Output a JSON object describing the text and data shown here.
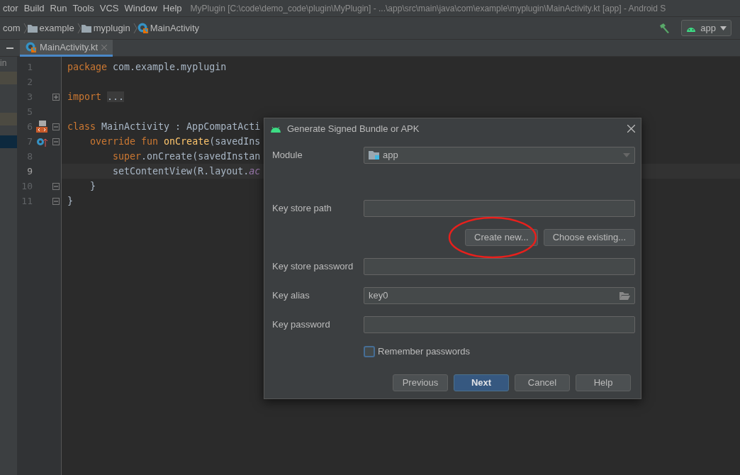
{
  "menu_bar": {
    "items": [
      "ctor",
      "Build",
      "Run",
      "Tools",
      "VCS",
      "Window",
      "Help"
    ],
    "title": "MyPlugin [C:\\code\\demo_code\\plugin\\MyPlugin] - ...\\app\\src\\main\\java\\com\\example\\myplugin\\MainActivity.kt [app] - Android S"
  },
  "breadcrumbs": [
    {
      "label": "com",
      "kind": "package"
    },
    {
      "label": "example",
      "kind": "folder"
    },
    {
      "label": "myplugin",
      "kind": "folder"
    },
    {
      "label": "MainActivity",
      "kind": "class"
    }
  ],
  "run_config": {
    "label": "app"
  },
  "side_panel": {
    "label": "in"
  },
  "tabs": [
    {
      "label": "MainActivity.kt",
      "selected": true
    }
  ],
  "editor": {
    "lines": [
      {
        "number": "1",
        "kind": "plain",
        "current": false,
        "tokens": [
          {
            "text": "package",
            "kind": "keyword"
          },
          {
            "text": " com.example.myplugin",
            "kind": "plain"
          }
        ]
      },
      {
        "number": "2",
        "kind": "plain",
        "current": false
      },
      {
        "number": "3",
        "kind": "plain",
        "current": false,
        "expanded": false,
        "tokens": [
          {
            "text": "import",
            "kind": "keyword"
          },
          {
            "text": "...",
            "kind": "folded"
          }
        ]
      },
      {
        "number": "5",
        "kind": "plain",
        "current": false
      },
      {
        "number": "6",
        "kind": "layout_marker",
        "current": false,
        "expanded": true,
        "tokens": [
          {
            "text": "class",
            "kind": "keyword"
          },
          {
            "text": " MainActivity : AppCompatActi",
            "kind": "plain"
          }
        ]
      },
      {
        "number": "7",
        "kind": "override_marker",
        "current": false,
        "expanded": true,
        "tokens": [
          {
            "text": "    override fun",
            "kind": "keyword"
          },
          {
            "text": " onCreate",
            "kind": "function"
          },
          {
            "text": "(savedIns",
            "kind": "plain"
          }
        ]
      },
      {
        "number": "8",
        "kind": "plain",
        "current": false,
        "tokens": [
          {
            "text": "        super",
            "kind": "keyword"
          },
          {
            "text": ".onCreate(savedInstan",
            "kind": "plain"
          }
        ]
      },
      {
        "number": "9",
        "kind": "plain",
        "current": true,
        "tokens": [
          {
            "text": "        setContentView(R.layout.",
            "kind": "plain"
          },
          {
            "text": "ac",
            "kind": "field"
          }
        ]
      },
      {
        "number": "10",
        "kind": "plain",
        "current": false,
        "expanded": true,
        "tokens": [
          {
            "text": "    }",
            "kind": "brace"
          }
        ]
      },
      {
        "number": "11",
        "kind": "plain",
        "current": false,
        "expanded": true,
        "tokens": [
          {
            "text": "}",
            "kind": "brace"
          }
        ]
      }
    ]
  },
  "dialog": {
    "title": "Generate Signed Bundle or APK",
    "rows": [
      {
        "kind": "select",
        "label": "Module",
        "value": "app"
      },
      {
        "kind": "spacer"
      },
      {
        "kind": "input",
        "label": "Key store path"
      },
      {
        "kind": "buttons",
        "buttons": [
          {
            "label": "Create new...",
            "circled": true
          },
          {
            "label": "Choose existing...",
            "circled": false
          }
        ]
      },
      {
        "kind": "input",
        "label": "Key store password"
      },
      {
        "kind": "browse",
        "label": "Key alias",
        "value": "key0"
      },
      {
        "kind": "input",
        "label": "Key password"
      },
      {
        "kind": "checkbox",
        "label": "Remember passwords",
        "checked": false
      }
    ],
    "footer": [
      {
        "label": "Previous",
        "default": false
      },
      {
        "label": "Next",
        "default": true
      },
      {
        "label": "Cancel",
        "default": false
      },
      {
        "label": "Help",
        "default": false
      }
    ]
  }
}
